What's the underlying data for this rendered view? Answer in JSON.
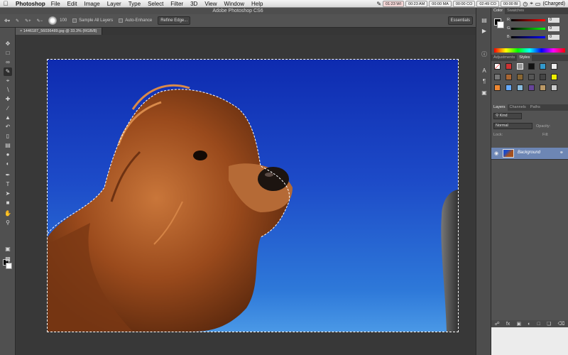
{
  "menubar": {
    "app_name": "Photoshop",
    "items": [
      "File",
      "Edit",
      "Image",
      "Layer",
      "Type",
      "Select",
      "Filter",
      "3D",
      "View",
      "Window",
      "Help"
    ],
    "status": [
      "01:23 WI",
      "00:23 AM",
      "00:00 MA",
      "00:00 CO",
      "02:49 CO",
      "00:00 BI"
    ],
    "battery_label": "(Charged)"
  },
  "window": {
    "title": "Adobe Photoshop CS6"
  },
  "options_bar": {
    "brush_size": "100",
    "sample_all_layers": "Sample All Layers",
    "auto_enhance": "Auto-Enhance",
    "refine_edge": "Refine Edge...",
    "workspace": "Essentials"
  },
  "document": {
    "tab_label": "1446187_56036489.jpg @ 33.3% (RGB/8)"
  },
  "panels": {
    "color_tabs": [
      "Color",
      "Swatches"
    ],
    "color_sliders": [
      {
        "label": "R",
        "value": "0",
        "gradient": "#ff0000"
      },
      {
        "label": "G",
        "value": "0",
        "gradient": "#00ff00"
      },
      {
        "label": "B",
        "value": "0",
        "gradient": "#0000ff"
      }
    ],
    "style_tabs": [
      "Adjustments",
      "Styles"
    ],
    "layer_tabs": [
      "Layers",
      "Channels",
      "Paths"
    ],
    "kind_filter": "Kind",
    "blend_mode": "Normal",
    "opacity_label": "Opacity:",
    "lock_label": "Lock:",
    "fill_label": "Fill:",
    "layer_name": "Background"
  },
  "colors": {
    "sky_top": "#0e2bb0",
    "sky_bottom": "#4a98e6",
    "dog_fur": "#a4501e"
  },
  "icons": {
    "tools": [
      "move-icon",
      "marquee-icon",
      "lasso-icon",
      "quick-select-icon",
      "crop-icon",
      "eyedropper-icon",
      "healing-icon",
      "brush-icon",
      "stamp-icon",
      "history-brush-icon",
      "eraser-icon",
      "gradient-icon",
      "blur-icon",
      "dodge-icon",
      "pen-icon",
      "type-icon",
      "path-select-icon",
      "shape-icon",
      "hand-icon",
      "zoom-icon"
    ]
  }
}
